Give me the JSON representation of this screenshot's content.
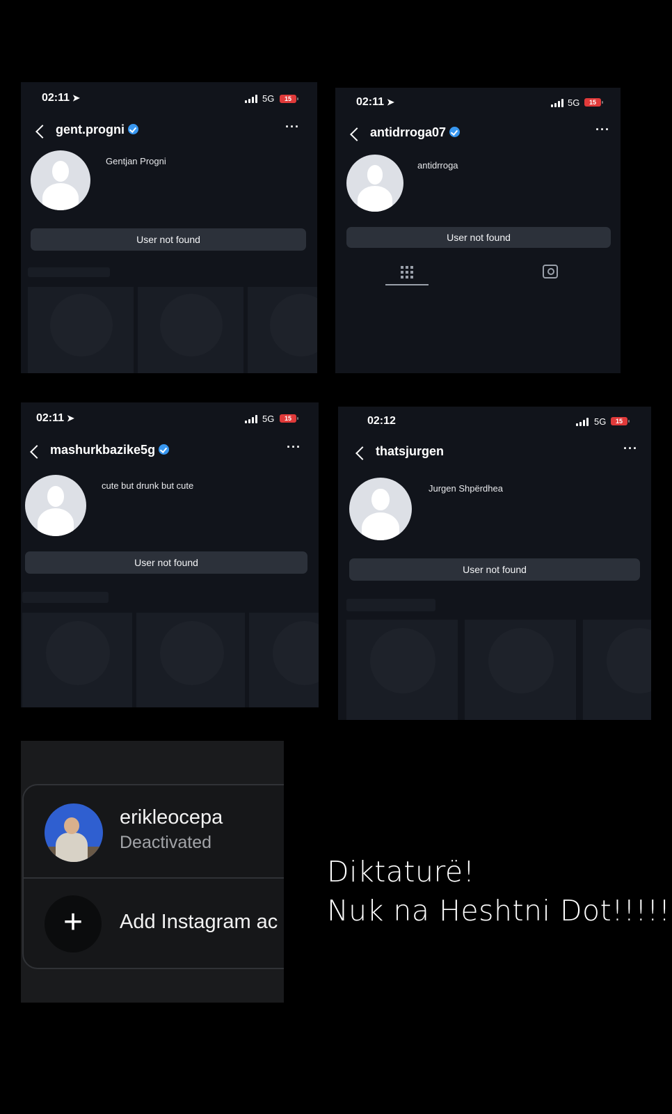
{
  "cards": [
    {
      "status": {
        "time": "02:11",
        "network": "5G",
        "battery": "15",
        "location_arrow": true
      },
      "username": "gent.progni",
      "verified": true,
      "bio": "Gentjan Progni",
      "button": "User not found"
    },
    {
      "status": {
        "time": "02:11",
        "network": "5G",
        "battery": "15",
        "location_arrow": true
      },
      "username": "antidrroga07",
      "verified": true,
      "bio": "antidrroga",
      "button": "User not found",
      "tabs": [
        "grid-icon",
        "tagged-icon"
      ]
    },
    {
      "status": {
        "time": "02:11",
        "network": "5G",
        "battery": "15",
        "location_arrow": true
      },
      "username": "mashurkbazike5g",
      "verified": true,
      "bio": "cute but drunk but cute",
      "button": "User not found"
    },
    {
      "status": {
        "time": "02:12",
        "network": "5G",
        "battery": "15",
        "location_arrow": false
      },
      "username": "thatsjurgen",
      "verified": false,
      "bio": "Jurgen Shpërdhea",
      "button": "User not found"
    }
  ],
  "account_switcher": {
    "account_name": "erikleocepa",
    "account_status": "Deactivated",
    "add_label": "Add Instagram ac",
    "plus_symbol": "+"
  },
  "message": {
    "line1": "Diktaturë!",
    "line2": "Nuk na Heshtni Dot!!!!!"
  },
  "ui_symbols": {
    "more": "···",
    "arrow": "➤"
  },
  "colors": {
    "verified": "#3897f0",
    "battery": "#e03a3a",
    "button": "#2c313a",
    "card_bg": "#11141b"
  }
}
